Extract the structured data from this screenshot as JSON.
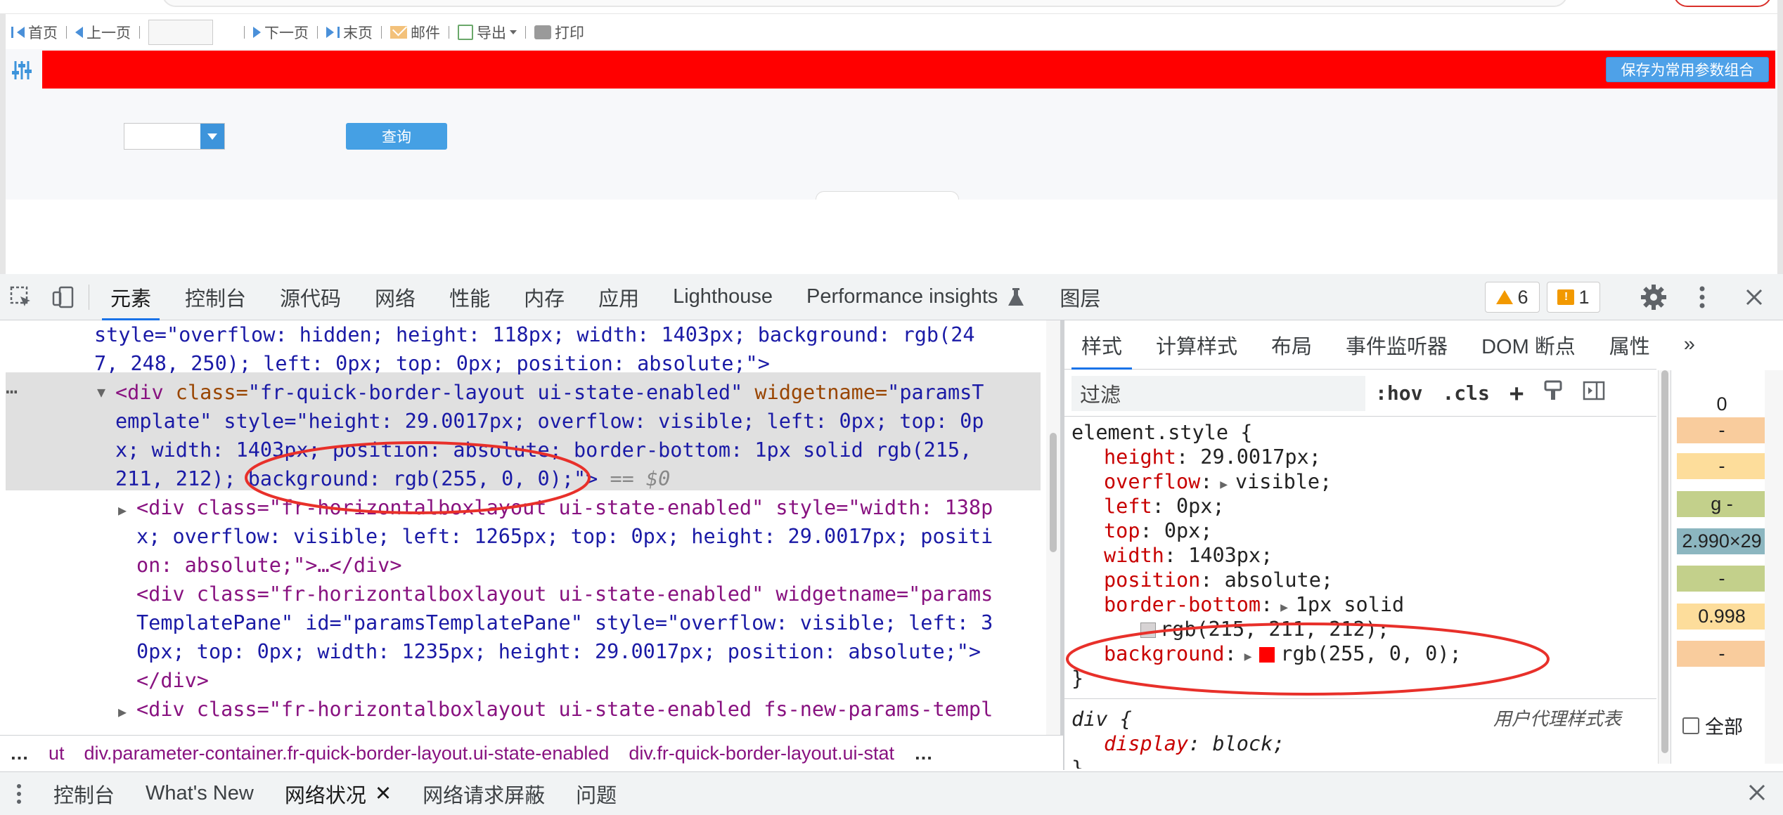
{
  "toolbar": {
    "first": "首页",
    "prev": "上一页",
    "next": "下一页",
    "last": "末页",
    "mail": "邮件",
    "export": "导出",
    "print": "打印"
  },
  "params": {
    "save_label": "保存为常用参数组合",
    "query_label": "查询",
    "bar_color": "rgb(255, 0, 0)"
  },
  "devtools": {
    "tabs": [
      "元素",
      "控制台",
      "源代码",
      "网络",
      "性能",
      "内存",
      "应用",
      "Lighthouse",
      "Performance insights",
      "图层"
    ],
    "warnings": "6",
    "issues": "1",
    "elements": {
      "l1": "style=\"overflow: hidden; height: 118px; width: 1403px; background: rgb(24",
      "l2": "7, 248, 250); left: 0px; top: 0px; position: absolute;\">",
      "l3_tag": "<div ",
      "l3_a1": "class=",
      "l3_v1": "\"fr-quick-border-layout ui-state-enabled\"",
      "l3_a2": " widgetname=",
      "l3_v2": "\"paramsT",
      "l4": "emplate\" style=\"height: 29.0017px; overflow: visible; left: 0px; top: 0p",
      "l5": "x; width: 1403px; position: absolute; border-bottom: 1px solid rgb(215,",
      "l6": "211, 212); background: rgb(255, 0, 0);\">",
      "l6_eq": " == $0",
      "l7": "<div class=\"fr-horizontalboxlayout ui-state-enabled\" style=\"width: 138p",
      "l8": "x; overflow: visible; left: 1265px; top: 0px; height: 29.0017px; positi",
      "l9": "on: absolute;\">…</div>",
      "l10": "<div class=\"fr-horizontalboxlayout ui-state-enabled\" widgetname=\"params",
      "l11": "TemplatePane\" id=\"paramsTemplatePane\" style=\"overflow: visible; left: 3",
      "l12": "0px; top: 0px; width: 1235px; height: 29.0017px; position: absolute;\">",
      "l13": "</div>",
      "l14": "<div class=\"fr-horizontalboxlayout ui-state-enabled fs-new-params-templ"
    },
    "breadcrumb": [
      "ut",
      "div.parameter-container.fr-quick-border-layout.ui-state-enabled",
      "div.fr-quick-border-layout.ui-stat"
    ],
    "style_tabs": [
      "样式",
      "计算样式",
      "布局",
      "事件监听器",
      "DOM 断点",
      "属性"
    ],
    "filter_placeholder": "过滤",
    "hov": ":hov",
    "cls": ".cls",
    "rules": {
      "selector": "element.style {",
      "p1": "height",
      "v1": " 29.0017px;",
      "p2": "overflow",
      "v2": "visible;",
      "p3": "left",
      "v3": " 0px;",
      "p4": "top",
      "v4": " 0px;",
      "p5": "width",
      "v5": " 1403px;",
      "p6": "position",
      "v6": " absolute;",
      "p7": "border-bottom",
      "v7": "1px solid",
      "v7b": "rgb(215, 211, 212);",
      "p8": "background",
      "v8": "rgb(255, 0, 0);",
      "close": "}",
      "ua_selector": "div {",
      "ua_label": "用户代理样式表",
      "ua_prop": "display",
      "ua_val": " block;",
      "ua_close": "}"
    },
    "boxmodel": [
      "0",
      "-",
      "-",
      "g -",
      "2.990×29",
      "-",
      "0.998",
      "-"
    ],
    "all_label": "全部",
    "drawer_tabs": [
      "控制台",
      "What's New",
      "网络状况",
      "网络请求屏蔽",
      "问题"
    ]
  }
}
